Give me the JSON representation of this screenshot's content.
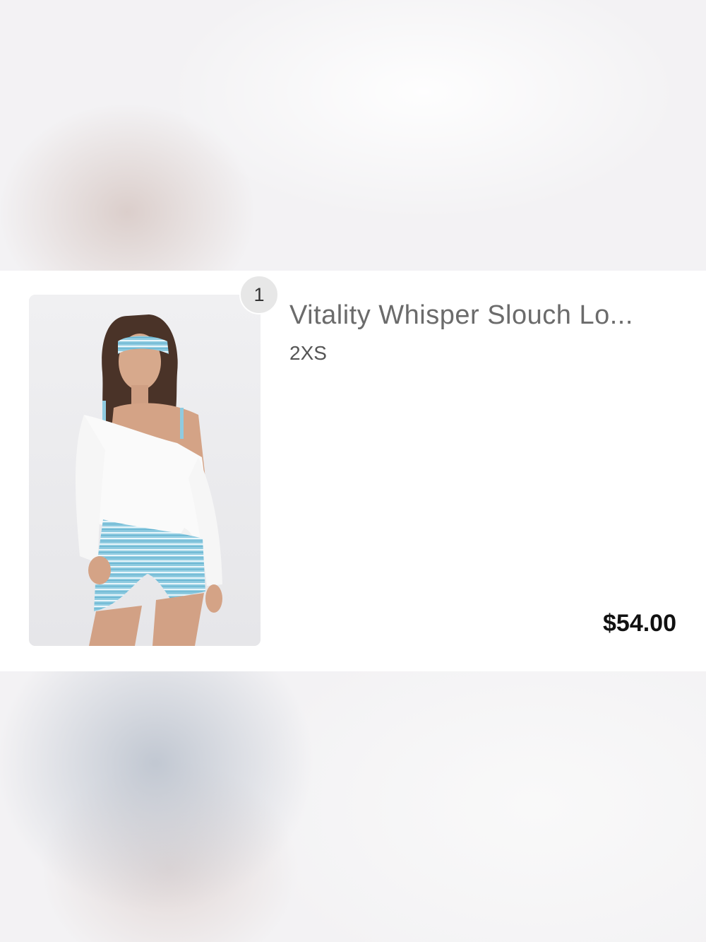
{
  "cart": {
    "items": [
      {
        "quantity": "1",
        "title": "Vitality Whisper Slouch Lo...",
        "variant": "2XS",
        "price": "$54.00",
        "image_alt": "Model wearing white off-shoulder slouch top with blue striped headband and shorts"
      }
    ]
  },
  "colors": {
    "card_background": "#ffffff",
    "badge_background": "#e7e7e7",
    "title_text": "#6b6b6b",
    "price_text": "#111111",
    "accent_stripe_blue": "#7ec4dc"
  }
}
